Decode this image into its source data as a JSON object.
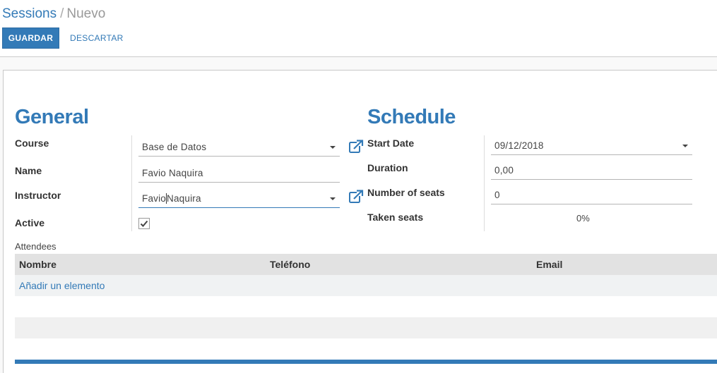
{
  "breadcrumb": {
    "parent": "Sessions",
    "separator": "/",
    "current": "Nuevo"
  },
  "toolbar": {
    "save_label": "GUARDAR",
    "discard_label": "DESCARTAR"
  },
  "general": {
    "title": "General",
    "course_label": "Course",
    "course_value": "Base de Datos",
    "name_label": "Name",
    "name_value": "Favio Naquira",
    "instructor_label": "Instructor",
    "instructor_before_cursor": "Favio",
    "instructor_after_cursor": "Naquira",
    "active_label": "Active",
    "active_checked": true
  },
  "schedule": {
    "title": "Schedule",
    "start_date_label": "Start Date",
    "start_date_value": "09/12/2018",
    "duration_label": "Duration",
    "duration_value": "0,00",
    "seats_label": "Number of seats",
    "seats_value": "0",
    "taken_label": "Taken seats",
    "taken_value": "0%"
  },
  "attendees": {
    "label": "Attendees",
    "columns": [
      "Nombre",
      "Teléfono",
      "Email"
    ],
    "add_label": "Añadir un elemento"
  },
  "colors": {
    "primary": "#337ab7",
    "header_bg": "#e2e2e2",
    "row_alt": "#f0f0f0",
    "row_hover": "#f0f2f3"
  },
  "icons": {
    "external_link": "external-link-icon",
    "dropdown": "caret-down-icon",
    "checkmark": "checkmark-icon"
  }
}
